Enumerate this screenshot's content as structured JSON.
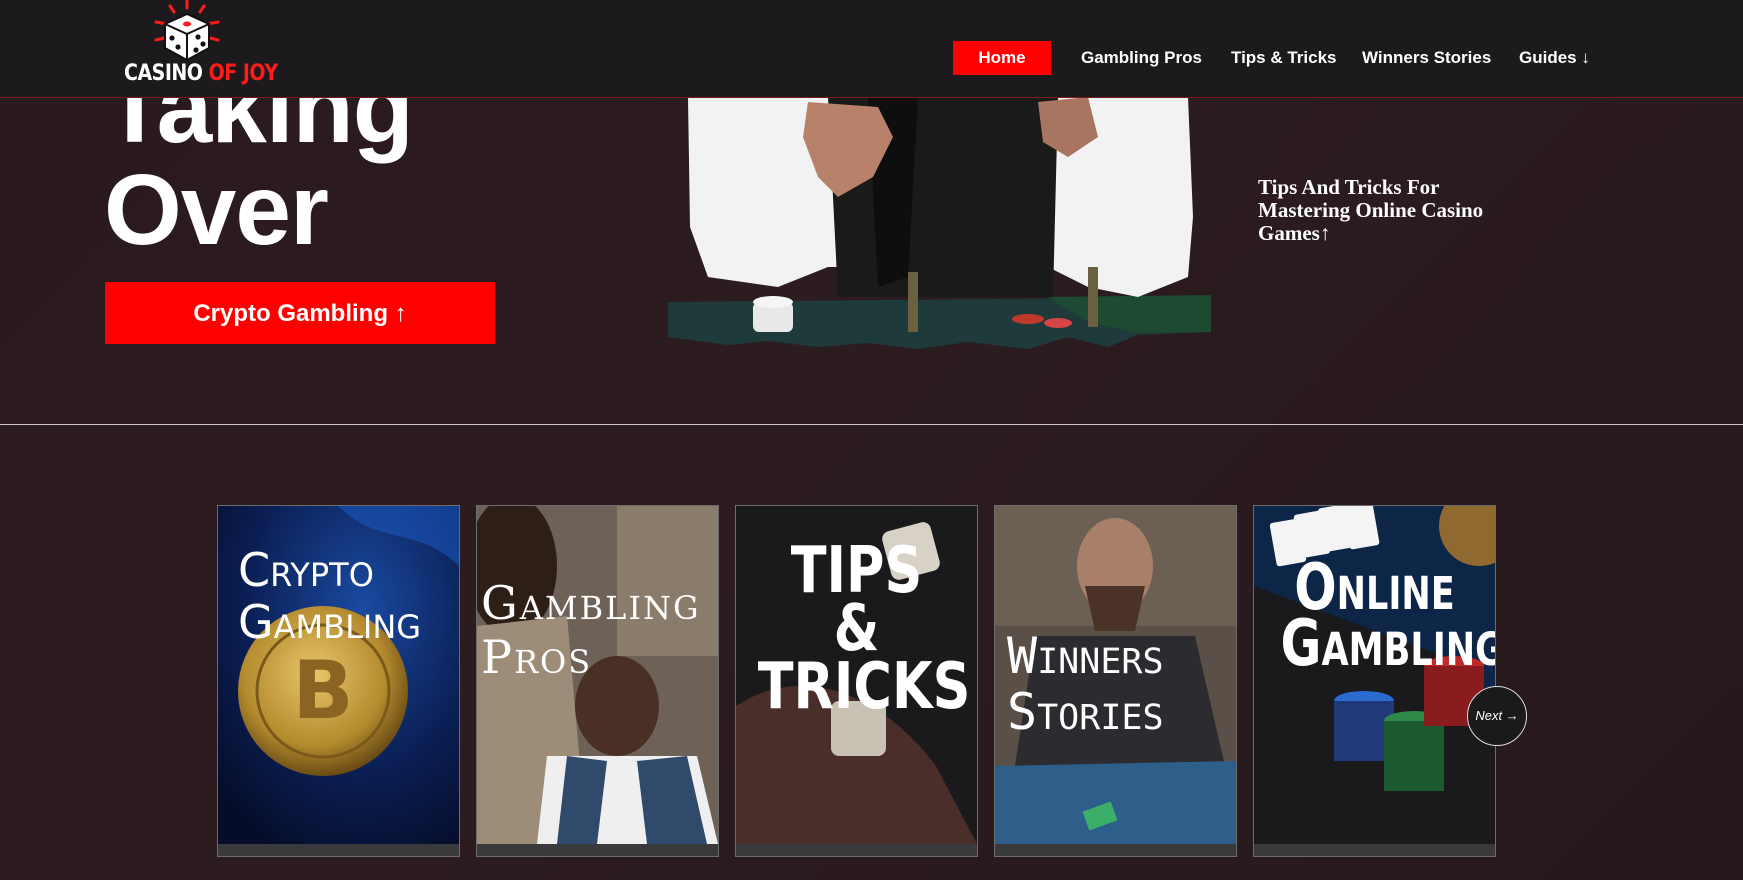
{
  "header": {
    "logo": {
      "text_a": "CASINO",
      "text_b": "OF JOY"
    },
    "nav": [
      {
        "label": "Home"
      },
      {
        "label": "Gambling Pros"
      },
      {
        "label": "Tips & Tricks"
      },
      {
        "label": "Winners Stories"
      },
      {
        "label": "Guides ↓"
      }
    ]
  },
  "hero": {
    "title_line1": "Taking",
    "title_line2": "Over",
    "cta_label": "Crypto Gambling ↑",
    "side_link": "Tips And Tricks For Mastering Online Casino Games↑"
  },
  "carousel": {
    "cards": [
      {
        "title": "Crypto\nGambling"
      },
      {
        "title": "Gambling\nPros"
      },
      {
        "title": "TIPS\n&\nTRICKS"
      },
      {
        "title": "Winners\nStories"
      },
      {
        "title": "Online\nGambling"
      }
    ],
    "next_label": "Next →"
  },
  "colors": {
    "accent": "#ff0000",
    "header_bg": "#1c1a1c",
    "page_bg": "#2b1b1f"
  }
}
